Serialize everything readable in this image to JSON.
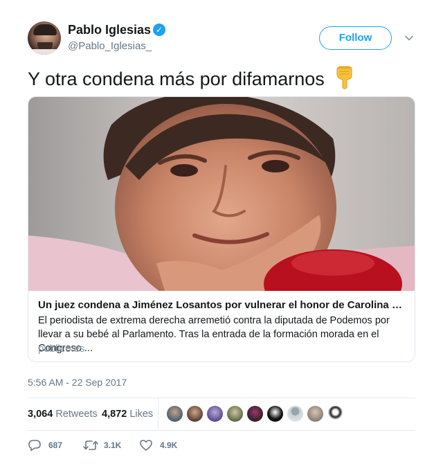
{
  "author": {
    "name": "Pablo Iglesias",
    "handle": "@Pablo_Iglesias_",
    "verified": true
  },
  "follow_label": "Follow",
  "tweet_text": "Y otra condena más por difamarnos",
  "emoji": "backhand-index-pointing-down",
  "card": {
    "title": "Un juez condena a Jiménez Losantos por vulnerar el honor de Carolina Bescansa",
    "description": "El periodista de extrema derecha arremetió contra la diputada de Podemos por llevar a su bebé al Parlamento. Tras la entrada de la formación morada en el Congreso ...",
    "domain": "publico.es"
  },
  "timestamp": "5:56 AM - 22 Sep 2017",
  "stats": {
    "retweets_count": "3,064",
    "retweets_label": "Retweets",
    "likes_count": "4,872",
    "likes_label": "Likes"
  },
  "actions": {
    "reply_count": "687",
    "retweet_count": "3.1K",
    "like_count": "4.9K"
  },
  "colors": {
    "accent": "#1da1f2",
    "text": "#14171a",
    "muted": "#657786",
    "border": "#e1e8ed"
  }
}
